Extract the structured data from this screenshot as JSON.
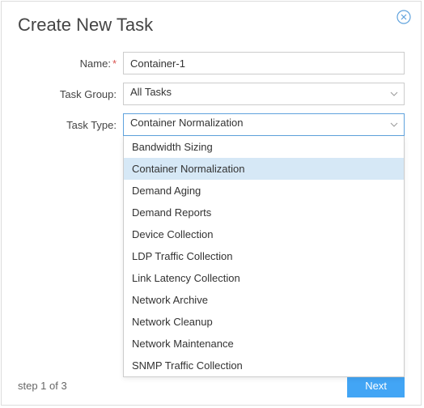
{
  "title": "Create New Task",
  "labels": {
    "name": "Name:",
    "task_group": "Task Group:",
    "task_type": "Task Type:"
  },
  "fields": {
    "name_value": "Container-1",
    "task_group_value": "All Tasks",
    "task_type_value": "Container Normalization"
  },
  "task_type_options": [
    "Bandwidth Sizing",
    "Container Normalization",
    "Demand Aging",
    "Demand Reports",
    "Device Collection",
    "LDP Traffic Collection",
    "Link Latency Collection",
    "Network Archive",
    "Network Cleanup",
    "Network Maintenance",
    "SNMP Traffic Collection"
  ],
  "task_type_selected_index": 1,
  "footer": {
    "step": "step 1 of 3",
    "next": "Next"
  }
}
